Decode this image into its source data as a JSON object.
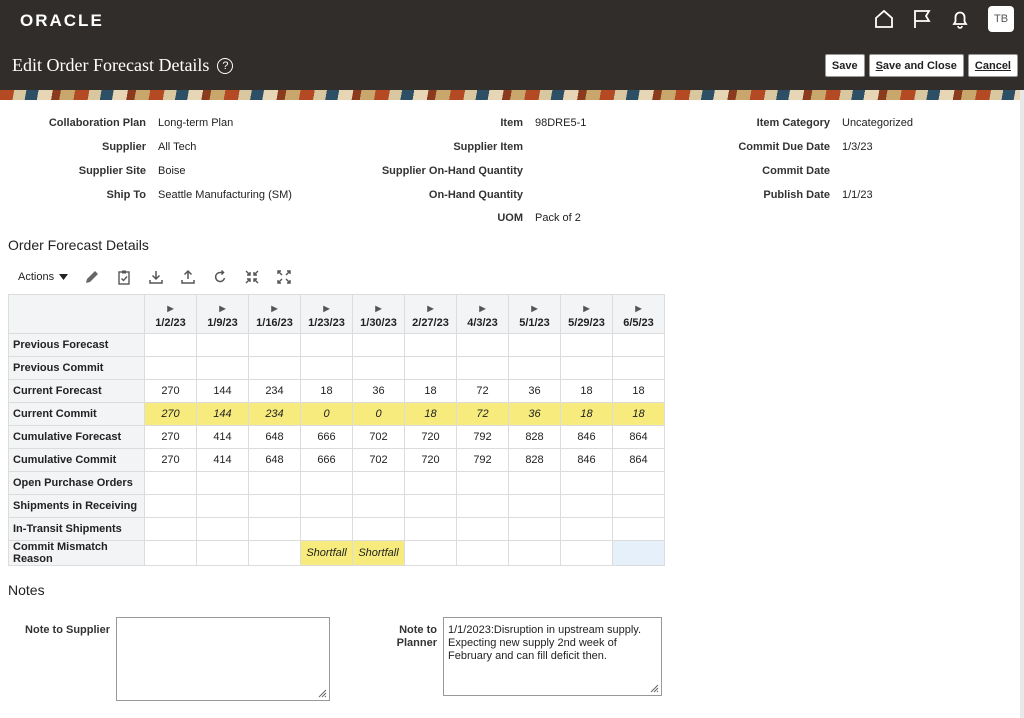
{
  "header": {
    "logo": "ORACLE",
    "avatar": "TB",
    "title": "Edit Order Forecast Details",
    "save": "Save",
    "save_close": "ave and Close",
    "save_close_prefix": "S",
    "cancel": "ancel",
    "cancel_prefix": "C"
  },
  "fields": {
    "collaboration_plan": {
      "label": "Collaboration Plan",
      "value": "Long-term Plan"
    },
    "supplier": {
      "label": "Supplier",
      "value": "All Tech"
    },
    "supplier_site": {
      "label": "Supplier Site",
      "value": "Boise"
    },
    "ship_to": {
      "label": "Ship To",
      "value": "Seattle Manufacturing (SM)"
    },
    "item": {
      "label": "Item",
      "value": "98DRE5-1"
    },
    "supplier_item": {
      "label": "Supplier Item",
      "value": ""
    },
    "supplier_on_hand": {
      "label": "Supplier On-Hand Quantity",
      "value": ""
    },
    "on_hand": {
      "label": "On-Hand Quantity",
      "value": ""
    },
    "uom": {
      "label": "UOM",
      "value": "Pack of 2"
    },
    "item_category": {
      "label": "Item Category",
      "value": "Uncategorized"
    },
    "commit_due_date": {
      "label": "Commit Due Date",
      "value": "1/3/23"
    },
    "commit_date": {
      "label": "Commit Date",
      "value": ""
    },
    "publish_date": {
      "label": "Publish Date",
      "value": "1/1/23"
    }
  },
  "forecast": {
    "section_title": "Order Forecast Details",
    "actions_label": "Actions",
    "columns": [
      "1/2/23",
      "1/9/23",
      "1/16/23",
      "1/23/23",
      "1/30/23",
      "2/27/23",
      "4/3/23",
      "5/1/23",
      "5/29/23",
      "6/5/23"
    ],
    "rows": [
      {
        "label": "Previous Forecast",
        "values": [
          "",
          "",
          "",
          "",
          "",
          "",
          "",
          "",
          "",
          ""
        ]
      },
      {
        "label": "Previous Commit",
        "values": [
          "",
          "",
          "",
          "",
          "",
          "",
          "",
          "",
          "",
          ""
        ]
      },
      {
        "label": "Current Forecast",
        "values": [
          "270",
          "144",
          "234",
          "18",
          "36",
          "18",
          "72",
          "36",
          "18",
          "18"
        ]
      },
      {
        "label": "Current Commit",
        "values": [
          "270",
          "144",
          "234",
          "0",
          "0",
          "18",
          "72",
          "36",
          "18",
          "18"
        ]
      },
      {
        "label": "Cumulative Forecast",
        "values": [
          "270",
          "414",
          "648",
          "666",
          "702",
          "720",
          "792",
          "828",
          "846",
          "864"
        ]
      },
      {
        "label": "Cumulative Commit",
        "values": [
          "270",
          "414",
          "648",
          "666",
          "702",
          "720",
          "792",
          "828",
          "846",
          "864"
        ]
      },
      {
        "label": "Open Purchase Orders",
        "values": [
          "",
          "",
          "",
          "",
          "",
          "",
          "",
          "",
          "",
          ""
        ]
      },
      {
        "label": "Shipments in Receiving",
        "values": [
          "",
          "",
          "",
          "",
          "",
          "",
          "",
          "",
          "",
          ""
        ]
      },
      {
        "label": "In-Transit Shipments",
        "values": [
          "",
          "",
          "",
          "",
          "",
          "",
          "",
          "",
          "",
          ""
        ]
      },
      {
        "label": "Commit Mismatch Reason",
        "values": [
          "",
          "",
          "",
          "Shortfall",
          "Shortfall",
          "",
          "",
          "",
          "",
          ""
        ]
      }
    ]
  },
  "notes": {
    "section_title": "Notes",
    "note_to_supplier_label": "Note to Supplier",
    "note_to_supplier_value": "",
    "note_to_planner_label_1": "Note to",
    "note_to_planner_label_2": "Planner",
    "note_to_planner_value": "1/1/2023:Disruption in upstream supply. Expecting new supply 2nd week of February and can fill deficit then."
  },
  "colors": {
    "header_bg": "#312d2a",
    "highlight": "#f6eb7c",
    "selected_cell": "#e6f0fa"
  }
}
